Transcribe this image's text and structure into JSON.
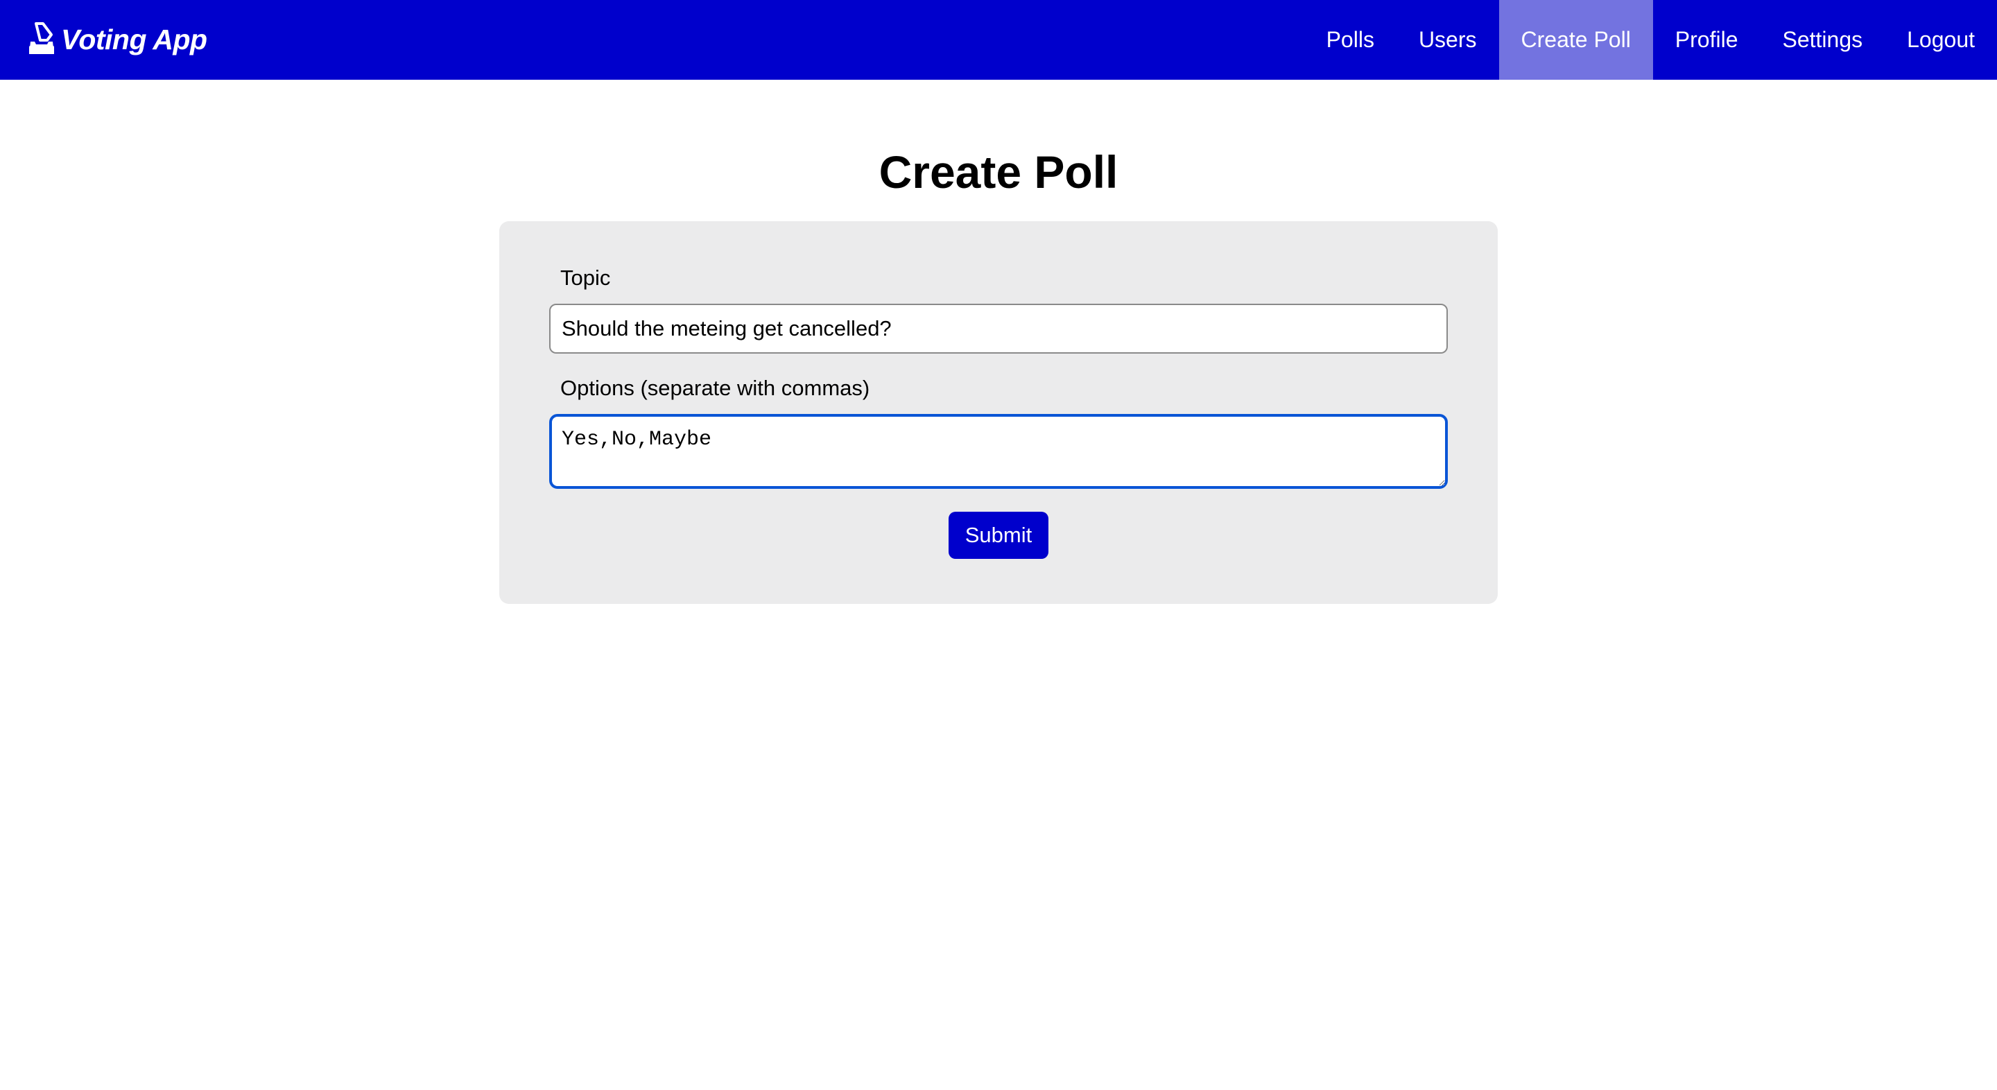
{
  "app": {
    "brand_name": "Voting App",
    "brand_icon": "ballot-box-icon"
  },
  "nav": {
    "items": [
      {
        "label": "Polls",
        "active": false
      },
      {
        "label": "Users",
        "active": false
      },
      {
        "label": "Create Poll",
        "active": true
      },
      {
        "label": "Profile",
        "active": false
      },
      {
        "label": "Settings",
        "active": false
      },
      {
        "label": "Logout",
        "active": false
      }
    ]
  },
  "page": {
    "title": "Create Poll"
  },
  "form": {
    "topic_label": "Topic",
    "topic_value": "Should the meteing get cancelled?",
    "options_label": "Options (separate with commas)",
    "options_value": "Yes,No,Maybe",
    "submit_label": "Submit"
  },
  "colors": {
    "navbar_bg": "#0000cc",
    "nav_active_bg": "#7373e0",
    "card_bg": "#ebebec",
    "focus_border": "#0a55d6",
    "button_bg": "#0000cc"
  }
}
